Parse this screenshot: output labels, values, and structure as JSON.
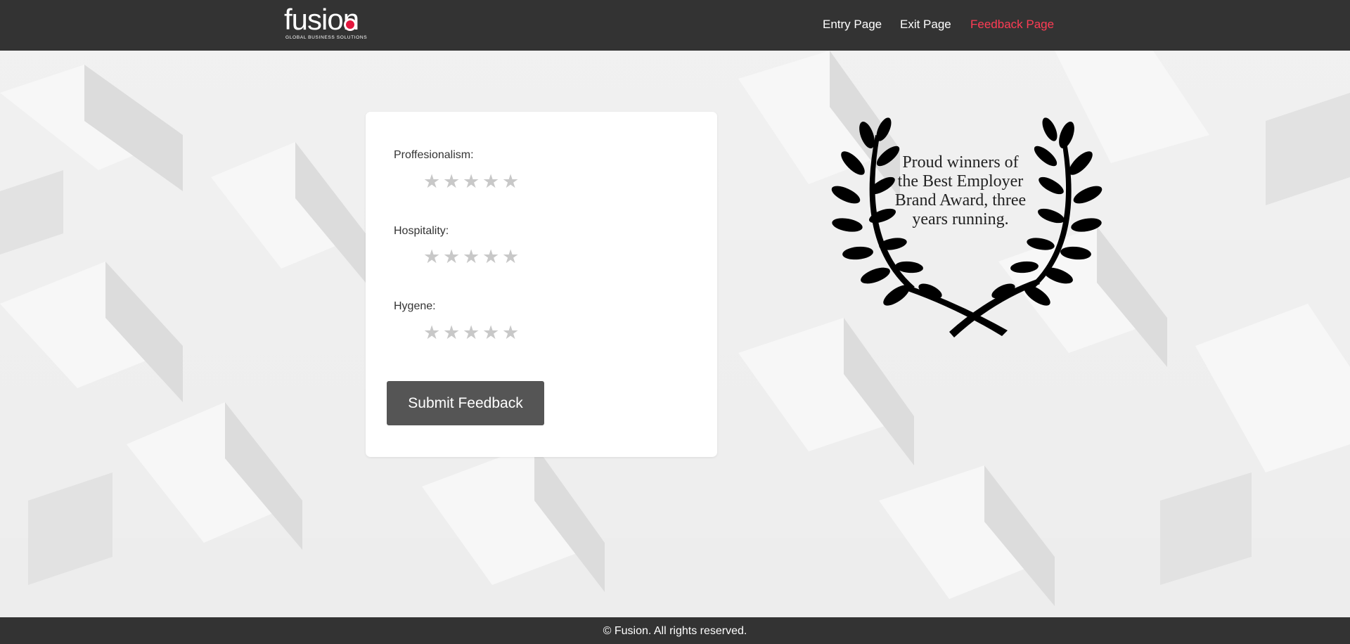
{
  "header": {
    "logo_word": "fusion",
    "logo_tagline": "GLOBAL BUSINESS SOLUTIONS",
    "nav": [
      {
        "label": "Entry Page",
        "active": false
      },
      {
        "label": "Exit Page",
        "active": false
      },
      {
        "label": "Feedback Page",
        "active": true
      }
    ]
  },
  "form": {
    "fields": [
      {
        "label": "Proffesionalism:",
        "rating": 0,
        "max": 5
      },
      {
        "label": "Hospitality:",
        "rating": 0,
        "max": 5
      },
      {
        "label": "Hygene:",
        "rating": 0,
        "max": 5
      }
    ],
    "star_glyph": "★",
    "submit_label": "Submit Feedback"
  },
  "award": {
    "text": "Proud winners of the Best Employer Brand Award, three years running.",
    "icon": "laurel-wreath-icon"
  },
  "footer": {
    "text": "© Fusion. All rights reserved."
  },
  "colors": {
    "header_bg": "#333333",
    "nav_active": "#ff3c55",
    "logo_dot": "#e3173e",
    "button_bg": "#555555",
    "star_inactive": "#c8c8c8"
  }
}
